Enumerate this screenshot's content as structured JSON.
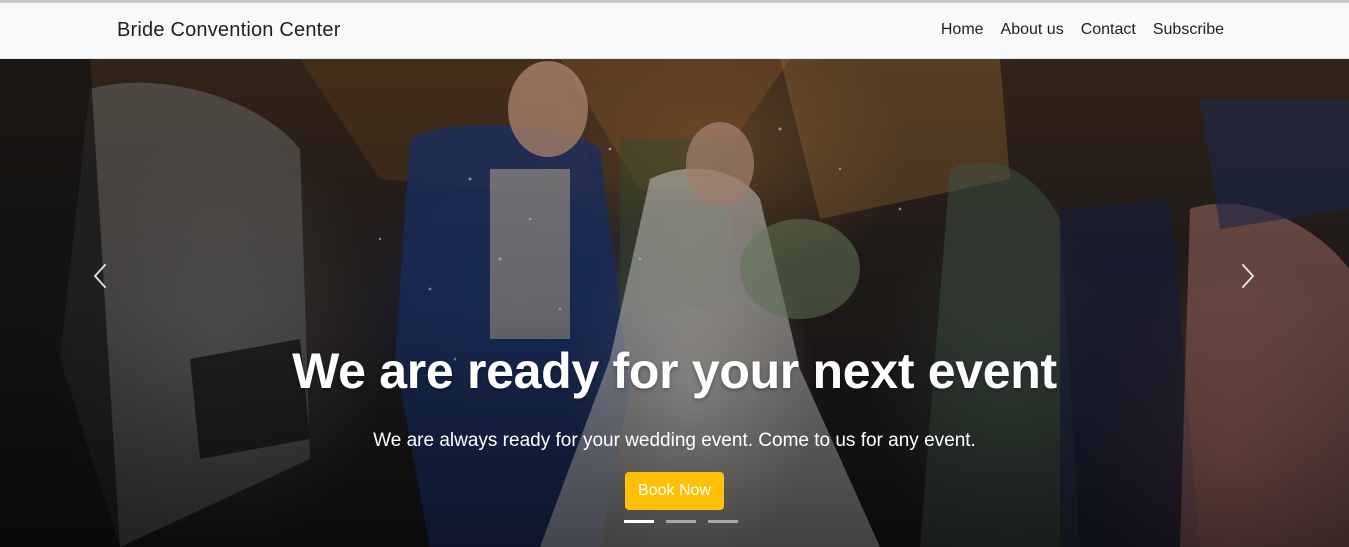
{
  "navbar": {
    "brand": "Bride Convention Center",
    "links": [
      {
        "label": "Home"
      },
      {
        "label": "About us"
      },
      {
        "label": "Contact"
      },
      {
        "label": "Subscribe"
      }
    ]
  },
  "hero": {
    "title": "We are ready for your next event",
    "subtitle": "We are always ready for your wedding event. Come to us for any event.",
    "cta_label": "Book Now",
    "prev_icon": "chevron-left-icon",
    "next_icon": "chevron-right-icon",
    "indicators": {
      "count": 3,
      "active_index": 0
    }
  },
  "colors": {
    "navbar_bg": "#f8f9fa",
    "cta_bg": "#ffc107",
    "text_light": "#ffffff"
  }
}
